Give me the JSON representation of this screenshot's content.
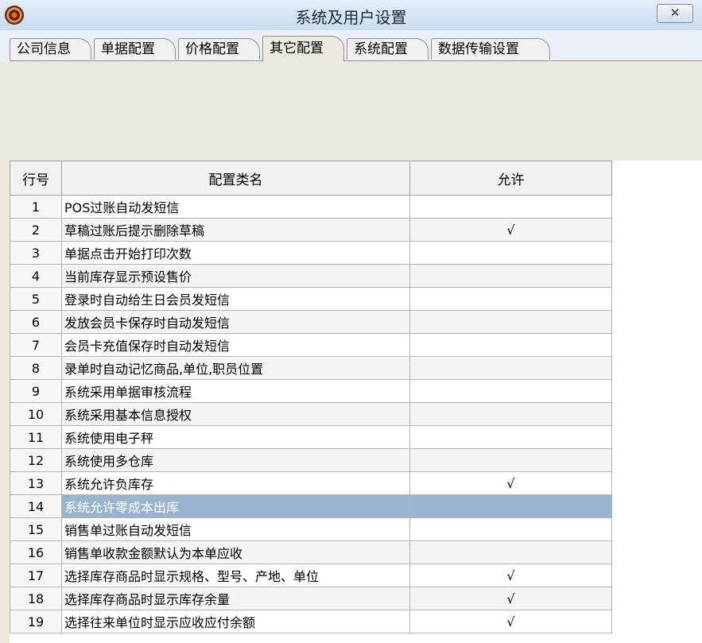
{
  "window": {
    "title": "系统及用户设置",
    "close_label": "✕"
  },
  "tabs": [
    {
      "label": "公司信息"
    },
    {
      "label": "单据配置"
    },
    {
      "label": "价格配置"
    },
    {
      "label": "其它配置"
    },
    {
      "label": "系统配置"
    },
    {
      "label": "数据传输设置"
    }
  ],
  "active_tab": "其它配置",
  "table": {
    "headers": [
      "行号",
      "配置类名",
      "允许"
    ],
    "rows": [
      {
        "num": "1",
        "name": "POS过账自动发短信",
        "allowed": ""
      },
      {
        "num": "2",
        "name": "草稿过账后提示删除草稿",
        "allowed": "√"
      },
      {
        "num": "3",
        "name": "单据点击开始打印次数",
        "allowed": ""
      },
      {
        "num": "4",
        "name": "当前库存显示预设售价",
        "allowed": ""
      },
      {
        "num": "5",
        "name": "登录时自动给生日会员发短信",
        "allowed": ""
      },
      {
        "num": "6",
        "name": "发放会员卡保存时自动发短信",
        "allowed": ""
      },
      {
        "num": "7",
        "name": "会员卡充值保存时自动发短信",
        "allowed": ""
      },
      {
        "num": "8",
        "name": "录单时自动记忆商品,单位,职员位置",
        "allowed": ""
      },
      {
        "num": "9",
        "name": "系统采用单据审核流程",
        "allowed": ""
      },
      {
        "num": "10",
        "name": "系统采用基本信息授权",
        "allowed": ""
      },
      {
        "num": "11",
        "name": "系统使用电子秤",
        "allowed": ""
      },
      {
        "num": "12",
        "name": "系统使用多仓库",
        "allowed": ""
      },
      {
        "num": "13",
        "name": "系统允许负库存",
        "allowed": "√"
      },
      {
        "num": "14",
        "name": "系统允许零成本出库",
        "allowed": ""
      },
      {
        "num": "15",
        "name": "销售单过账自动发短信",
        "allowed": ""
      },
      {
        "num": "16",
        "name": "销售单收款金额默认为本单应收",
        "allowed": ""
      },
      {
        "num": "17",
        "name": "选择库存商品时显示规格、型号、产地、单位",
        "allowed": "√"
      },
      {
        "num": "18",
        "name": "选择库存商品时显示库存余量",
        "allowed": "√"
      },
      {
        "num": "19",
        "name": "选择往来单位时显示应收应付余额",
        "allowed": "√"
      }
    ],
    "selected_row": "14"
  }
}
